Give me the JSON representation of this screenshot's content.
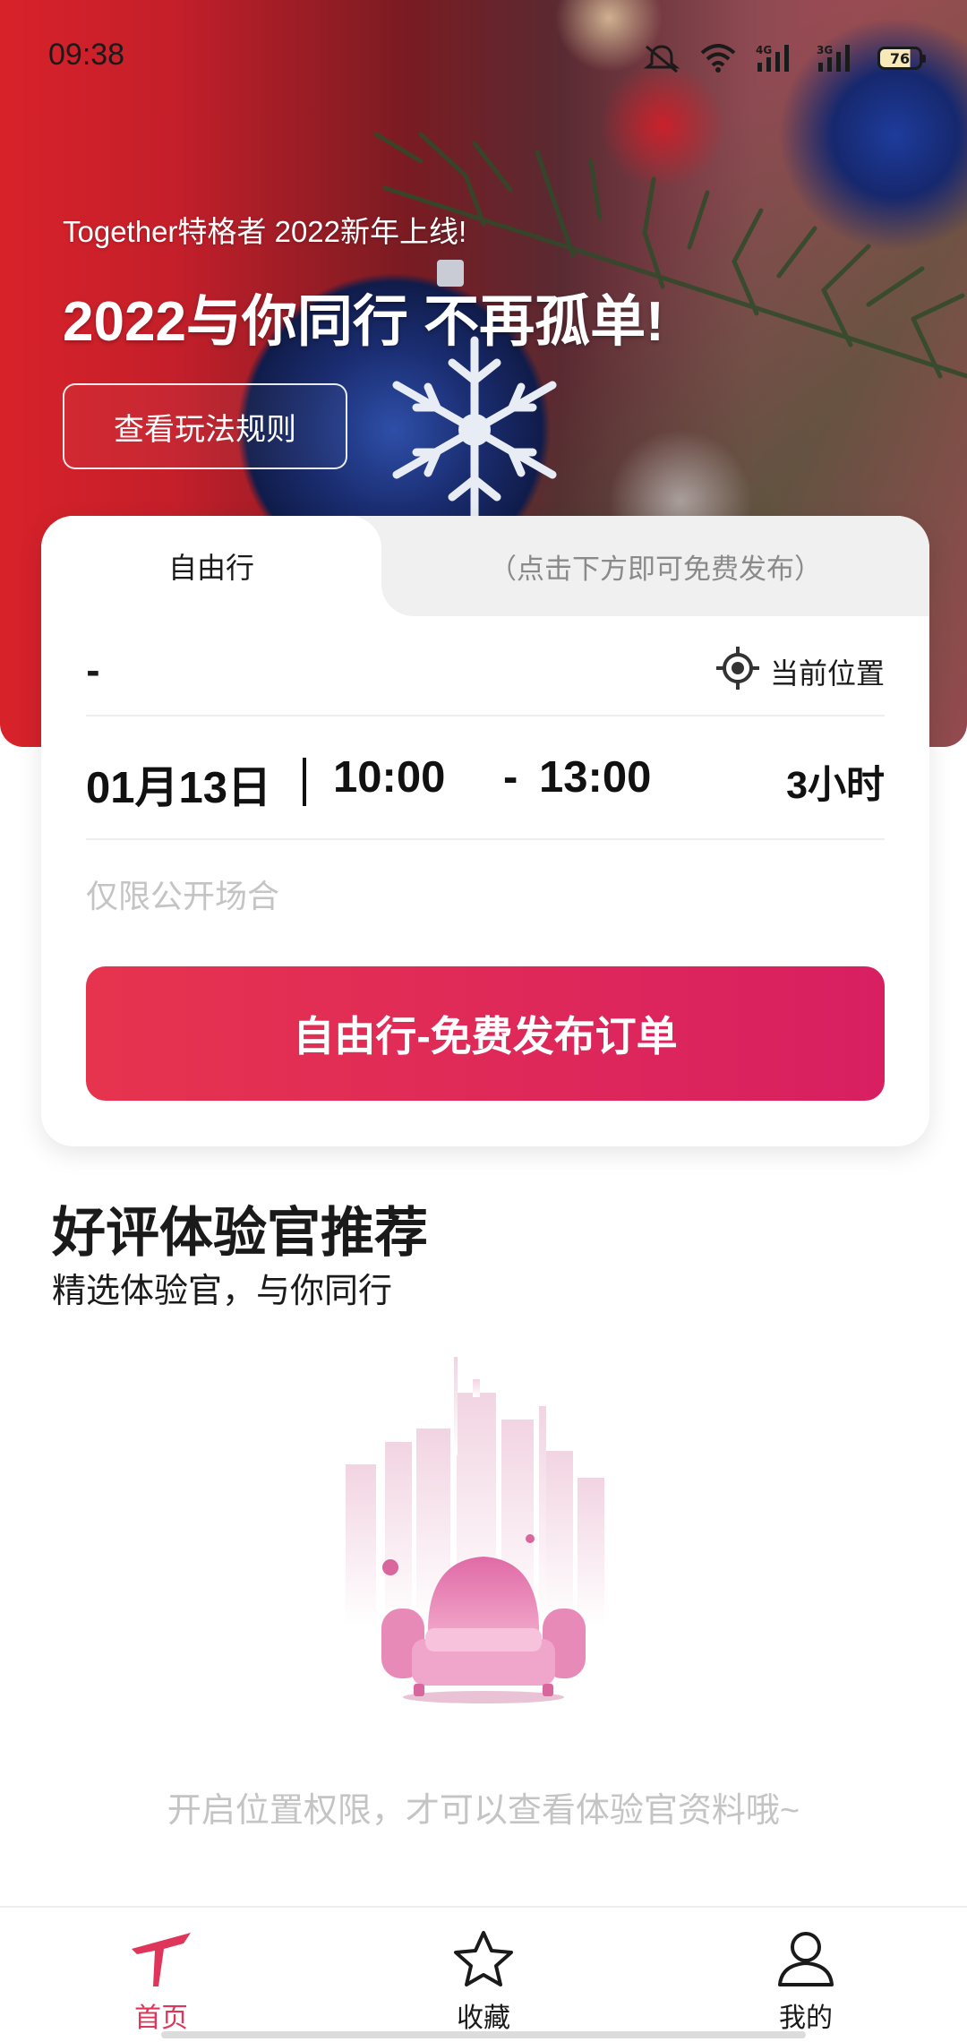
{
  "status_bar": {
    "time": "09:38",
    "battery": "76",
    "signal_1": "4G",
    "signal_2": "3G"
  },
  "hero": {
    "subtitle": "Together特格者 2022新年上线!",
    "title": "2022与你同行 不再孤单!",
    "rules_button": "查看玩法规则"
  },
  "order_card": {
    "tabs": [
      {
        "label": "自由行",
        "active": true
      },
      {
        "label": "（点击下方即可免费发布）",
        "active": false
      }
    ],
    "location_value": "-",
    "locate_label": "当前位置",
    "date": "01月13日",
    "time_start": "10:00",
    "time_sep": "-",
    "time_end": "13:00",
    "duration": "3小时",
    "note": "仅限公开场合",
    "publish_button": "自由行-免费发布订单"
  },
  "recommend": {
    "title": "好评体验官推荐",
    "subtitle": "精选体验官，与你同行",
    "empty_hint": "开启位置权限，才可以查看体验官资料哦~"
  },
  "bottom_nav": {
    "items": [
      {
        "label": "首页",
        "icon": "home-logo-icon",
        "active": true
      },
      {
        "label": "收藏",
        "icon": "star-icon",
        "active": false
      },
      {
        "label": "我的",
        "icon": "user-icon",
        "active": false
      }
    ]
  },
  "colors": {
    "accent": "#e0355a",
    "button_gradient_start": "#e6344e",
    "button_gradient_end": "#d81f62",
    "hero_red": "#d8222a",
    "placeholder_gray": "#c4c4c4"
  }
}
